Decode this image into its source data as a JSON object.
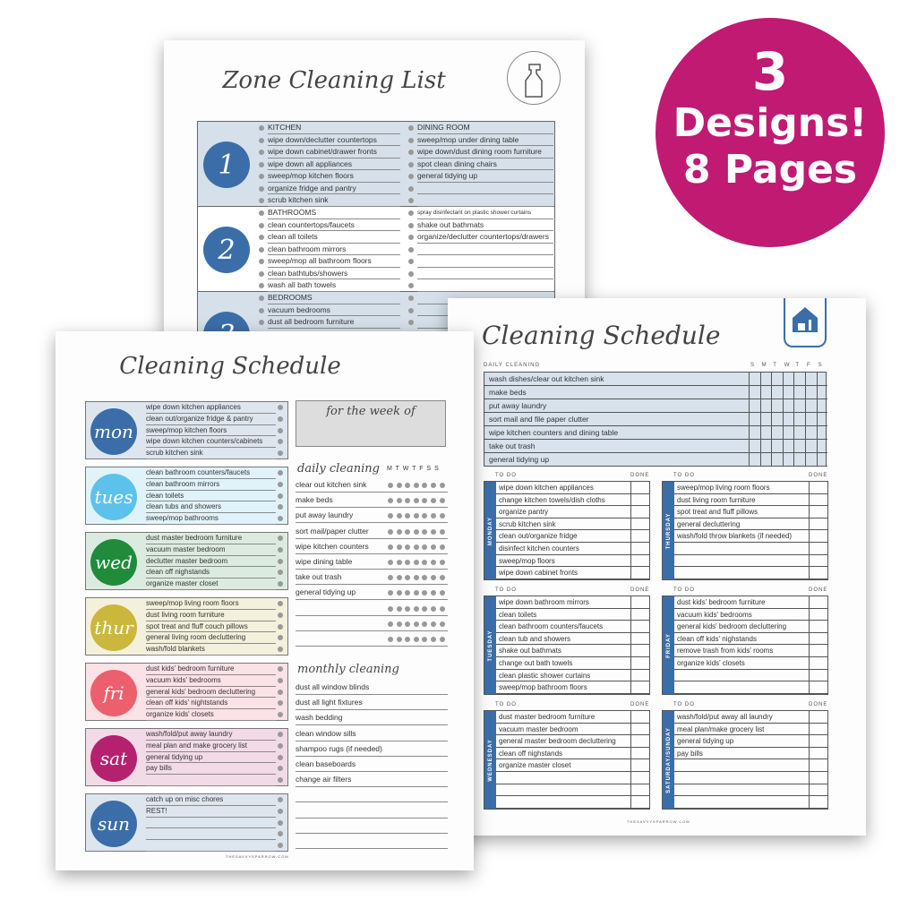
{
  "badge": {
    "line1": "3",
    "line2": "Designs!",
    "line3": "8 Pages",
    "color": "#c01a72"
  },
  "zone_page": {
    "title": "Zone Cleaning List",
    "icon": "spray-bottle-icon",
    "zones": [
      {
        "number": "1",
        "left": [
          "KITCHEN",
          "wipe down/declutter countertops",
          "wipe down cabinet/drawer fronts",
          "wipe down all appliances",
          "sweep/mop kitchen floors",
          "organize fridge and pantry",
          "scrub kitchen sink"
        ],
        "right": [
          "DINING ROOM",
          "sweep/mop under dining table",
          "wipe down/dust dining room furniture",
          "spot clean dining chairs",
          "general tidying up",
          "",
          ""
        ]
      },
      {
        "number": "2",
        "left": [
          "BATHROOMS",
          "clean countertops/faucets",
          "clean all toilets",
          "clean bathroom mirrors",
          "sweep/mop all bathroom floors",
          "clean bathtubs/showers",
          "wash all bath towels"
        ],
        "right": [
          "spray disinfectant on plastic shower curtains",
          "shake out bathmats",
          "organize/declutter countertops/drawers",
          "",
          "",
          "",
          ""
        ]
      },
      {
        "number": "3",
        "left": [
          "BEDROOMS",
          "vacuum bedrooms",
          "dust all bedroom furniture"
        ],
        "right": [
          "",
          "",
          ""
        ]
      }
    ]
  },
  "weekly_page": {
    "title": "Cleaning Schedule",
    "week_label": "for the week of",
    "footer": "THESAVVYSPARROW.COM",
    "days": [
      {
        "label": "mon",
        "color": "#3b6ea8",
        "bg": "#dde6ef",
        "items": [
          "wipe down kitchen appliances",
          "clean out/organize fridge & pantry",
          "sweep/mop kitchen floors",
          "wipe down kitchen counters/cabinets",
          "scrub kitchen sink"
        ]
      },
      {
        "label": "tues",
        "color": "#5cc2ec",
        "bg": "#e1f3fa",
        "items": [
          "clean bathroom counters/faucets",
          "clean bathroom mirrors",
          "clean toilets",
          "clean tubs and showers",
          "sweep/mop bathrooms"
        ]
      },
      {
        "label": "wed",
        "color": "#1f8b3b",
        "bg": "#dcebdf",
        "items": [
          "dust master bedroom furniture",
          "vacuum master bedroom",
          "declutter master bedroom",
          "clean off nighstands",
          "organize master closet"
        ]
      },
      {
        "label": "thur",
        "color": "#cbb73c",
        "bg": "#f3f0dc",
        "items": [
          "sweep/mop living room floors",
          "dust living room furniture",
          "spot treat and fluff couch pillows",
          "general living room decluttering",
          "wash/fold blankets"
        ]
      },
      {
        "label": "fri",
        "color": "#ec5f6c",
        "bg": "#fbe2e6",
        "items": [
          "dust kids' bedroom furniture",
          "vacuum kids' bedrooms",
          "general kids' bedroom decluttering",
          "clean off kids' nightstands",
          "organize kids' closets"
        ]
      },
      {
        "label": "sat",
        "color": "#b4226f",
        "bg": "#f2dbe6",
        "items": [
          "wash/fold/put away laundry",
          "meal plan and make grocery list",
          "general tidying up",
          "pay bills",
          ""
        ]
      },
      {
        "label": "sun",
        "color": "#3b6ea8",
        "bg": "#dde6ef",
        "items": [
          "catch up on misc chores",
          "REST!",
          "",
          "",
          ""
        ]
      }
    ],
    "daily": {
      "title": "daily cleaning",
      "days_header": "M T W T F S S",
      "items": [
        "clear out kitchen sink",
        "make beds",
        "put away laundry",
        "sort mail/paper clutter",
        "wipe kitchen counters",
        "wipe dining table",
        "take out trash",
        "general tidying up",
        "",
        "",
        ""
      ]
    },
    "monthly": {
      "title": "monthly cleaning",
      "items": [
        "dust all window blinds",
        "dust all light fixtures",
        "wash bedding",
        "clean window sills",
        "shampoo rugs (if needed)",
        "clean baseboards",
        "change air filters",
        "",
        "",
        "",
        ""
      ]
    }
  },
  "blue_page": {
    "title": "Cleaning Schedule",
    "icon": "house-cleaning-icon",
    "accent": "#3b6ea8",
    "daily_label": "DAILY CLEANING",
    "day_cols": [
      "S",
      "M",
      "T",
      "W",
      "T",
      "F",
      "S"
    ],
    "daily": [
      "wash dishes/clear out kitchen sink",
      "make beds",
      "put away laundry",
      "sort mail and file paper clutter",
      "wipe kitchen counters and dining table",
      "take out trash",
      "general tidying up"
    ],
    "todo_label": "TO DO",
    "done_label": "DONE",
    "footer": "THESAVVYSPARROW.COM",
    "blocks": [
      {
        "day": "MONDAY",
        "items": [
          "wipe down kitchen appliances",
          "change kitchen towels/dish cloths",
          "organize pantry",
          "scrub kitchen sink",
          "clean out/organize fridge",
          "disinfect kitchen counters",
          "sweep/mop floors",
          "wipe down cabinet fronts"
        ]
      },
      {
        "day": "THURSDAY",
        "items": [
          "sweep/mop living room floors",
          "dust living room furniture",
          "spot treat and fluff pillows",
          "general decluttering",
          "wash/fold throw blankets (if needed)",
          "",
          "",
          ""
        ]
      },
      {
        "day": "TUESDAY",
        "items": [
          "wipe down bathroom mirrors",
          "clean toilets",
          "clean bathroom counters/faucets",
          "clean tub and showers",
          "shake out bathmats",
          "change out bath towels",
          "clean plastic shower curtains",
          "sweep/mop bathroom floors"
        ]
      },
      {
        "day": "FRIDAY",
        "items": [
          "dust kids' bedroom furniture",
          "vacuum kids' bedrooms",
          "general kids' bedroom decluttering",
          "clean off kids' nighstands",
          "remove trash from kids' rooms",
          "organize kids' closets",
          "",
          ""
        ]
      },
      {
        "day": "WEDNESDAY",
        "items": [
          "dust master bedroom furniture",
          "vacuum master bedroom",
          "general master bedroom decluttering",
          "clean off nighstands",
          "organize master closet",
          "",
          "",
          ""
        ]
      },
      {
        "day": "SATURDAY/SUNDAY",
        "items": [
          "wash/fold/put away all laundry",
          "meal plan/make grocery list",
          "general tidying up",
          "pay bills",
          "",
          "",
          "",
          ""
        ]
      }
    ]
  }
}
